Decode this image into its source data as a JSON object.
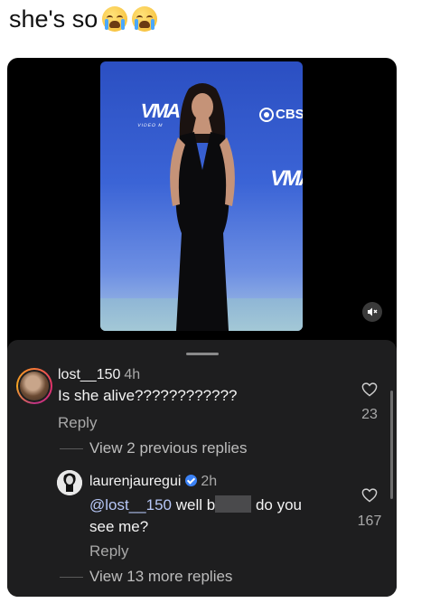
{
  "post": {
    "caption": "she's so",
    "emoji": [
      "loudly-crying-face-emoji",
      "loudly-crying-face-emoji"
    ]
  },
  "media": {
    "brand_logo": "VMA",
    "brand_logo_small": "VIDEO M",
    "network_logo": "CBS",
    "mute_icon": "speaker-muted-icon"
  },
  "comments": {
    "top": {
      "username": "lost__150",
      "time": "4h",
      "text": "Is she alive????????????",
      "reply_label": "Reply",
      "likes": "23",
      "view_previous": "View 2 previous replies"
    },
    "reply": {
      "username": "laurenjauregui",
      "verified": true,
      "time": "2h",
      "mention": "@lost__150",
      "text_before_redaction": "well b",
      "text_after_redaction": "do you",
      "text_line2": "see me?",
      "reply_label": "Reply",
      "likes": "167",
      "view_more": "View 13 more replies"
    }
  },
  "colors": {
    "sheet_bg": "#1e1e1f",
    "text_primary": "#f3f3f3",
    "text_muted": "#a8a8a8",
    "mention": "#b7c7f7",
    "verified_badge": "#3b82f6"
  }
}
